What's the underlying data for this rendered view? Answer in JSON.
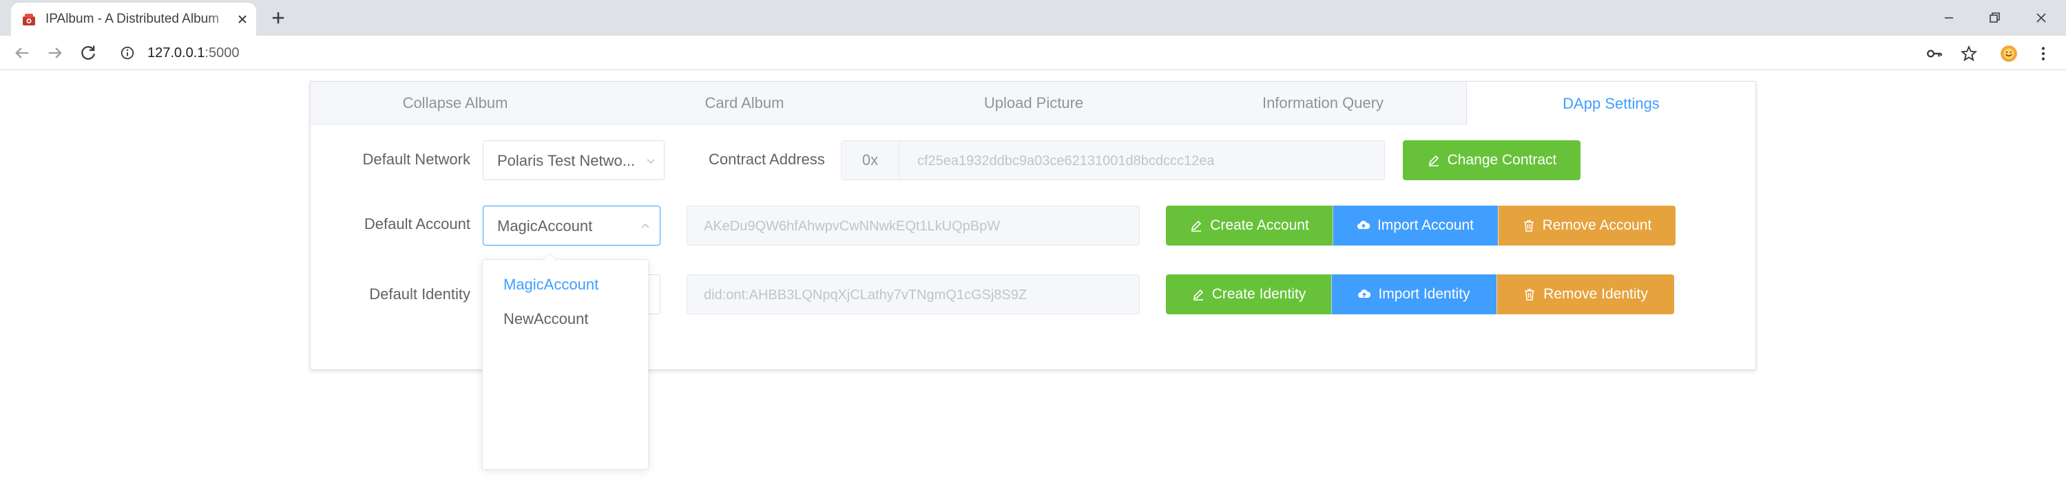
{
  "browser": {
    "tab_title": "IPAlbum - A Distributed Album",
    "url_host": "127.0.0.1",
    "url_port": ":5000"
  },
  "app": {
    "tabs": [
      {
        "label": "Collapse Album"
      },
      {
        "label": "Card Album"
      },
      {
        "label": "Upload Picture"
      },
      {
        "label": "Information Query"
      },
      {
        "label": "DApp Settings"
      }
    ],
    "active_tab": "DApp Settings"
  },
  "settings": {
    "network": {
      "label": "Default Network",
      "value": "Polaris Test Netwo..."
    },
    "contract": {
      "label": "Contract Address",
      "prefix": "0x",
      "value": "cf25ea1932ddbc9a03ce62131001d8bcdccc12ea",
      "button": "Change Contract"
    },
    "account": {
      "label": "Default Account",
      "value": "MagicAccount",
      "address": "AKeDu9QW6hfAhwpvCwNNwkEQt1LkUQpBpW",
      "buttons": {
        "create": "Create Account",
        "import": "Import Account",
        "remove": "Remove Account"
      }
    },
    "identity": {
      "label": "Default Identity",
      "value": "did:ont:AHBB3LQNpqXjCLathy7vTNgmQ1cGSj8S9Z",
      "buttons": {
        "create": "Create Identity",
        "import": "Import Identity",
        "remove": "Remove Identity"
      }
    }
  },
  "dropdown": {
    "options": [
      "MagicAccount",
      "NewAccount"
    ],
    "selected": "MagicAccount"
  },
  "colors": {
    "primary": "#409eff",
    "success": "#67c23a",
    "warning": "#e6a23c"
  }
}
